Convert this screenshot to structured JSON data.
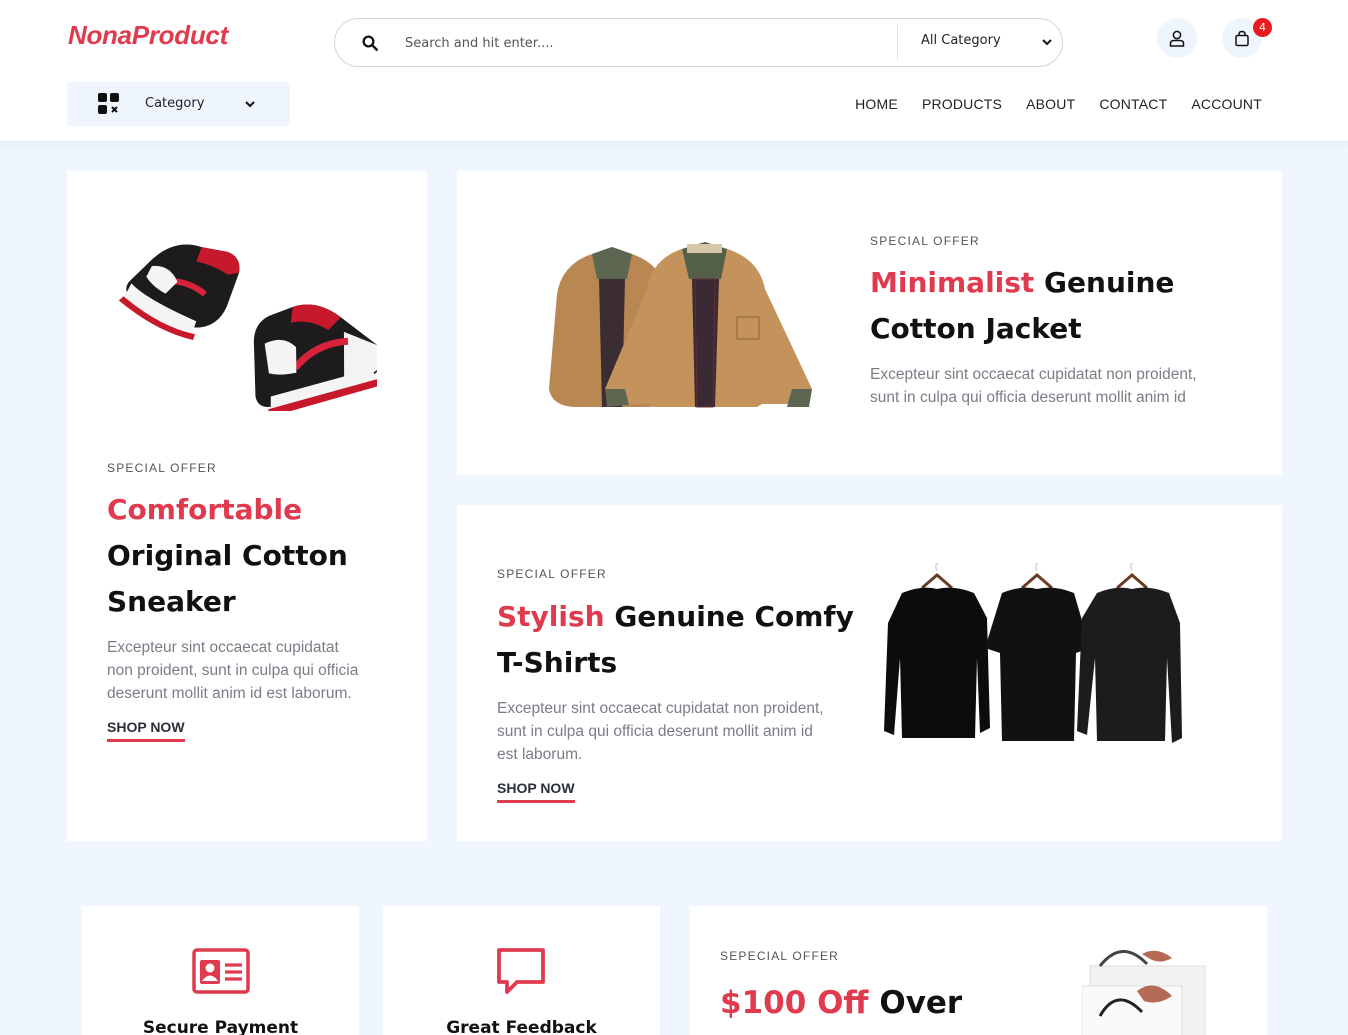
{
  "header": {
    "logo": "NonaProduct",
    "search": {
      "placeholder": "Search and hit enter....",
      "value": ""
    },
    "category_select": "All Category",
    "cart_count": "4",
    "category_button": "Category",
    "nav": [
      "HOME",
      "PRODUCTS",
      "ABOUT",
      "CONTACT",
      "ACCOUNT"
    ]
  },
  "colors": {
    "accent": "#e03a4f",
    "background": "#f0f6fd",
    "badge": "#e81c1c"
  },
  "icons": [
    "search-icon",
    "chevron-down-icon",
    "user-icon",
    "shopping-bag-icon",
    "grid-category-icon",
    "id-card-icon",
    "chat-bubble-icon"
  ],
  "cards": {
    "sneaker": {
      "eyebrow": "SPECIAL OFFER",
      "accent": "Comfortable",
      "line2": "Original Cotton",
      "line3": "Sneaker",
      "desc_lines": [
        "Excepteur sint occaecat cupidatat",
        "non proident, sunt in culpa qui officia",
        "deserunt mollit anim id est laborum."
      ],
      "cta": "SHOP NOW"
    },
    "jacket": {
      "eyebrow": "SPECIAL OFFER",
      "accent": "Minimalist",
      "rest": " Genuine",
      "line2": "Cotton Jacket",
      "desc_lines": [
        "Excepteur sint occaecat cupidatat non proident,",
        "sunt in culpa qui officia deserunt mollit anim id"
      ]
    },
    "tshirt": {
      "eyebrow": "SPECIAL OFFER",
      "accent": "Stylish",
      "rest": " Genuine Comfy",
      "line2": "T-Shirts",
      "desc_lines": [
        "Excepteur sint occaecat cupidatat non proident,",
        "sunt in culpa qui officia deserunt mollit anim id",
        "est laborum."
      ],
      "cta": "SHOP NOW"
    },
    "feature_payment": {
      "title": "Secure Payment"
    },
    "feature_feedback": {
      "title": "Great Feedback"
    },
    "promo": {
      "eyebrow": "SEPECIAL OFFER",
      "accent": "$100 Off",
      "rest": " Over"
    }
  }
}
